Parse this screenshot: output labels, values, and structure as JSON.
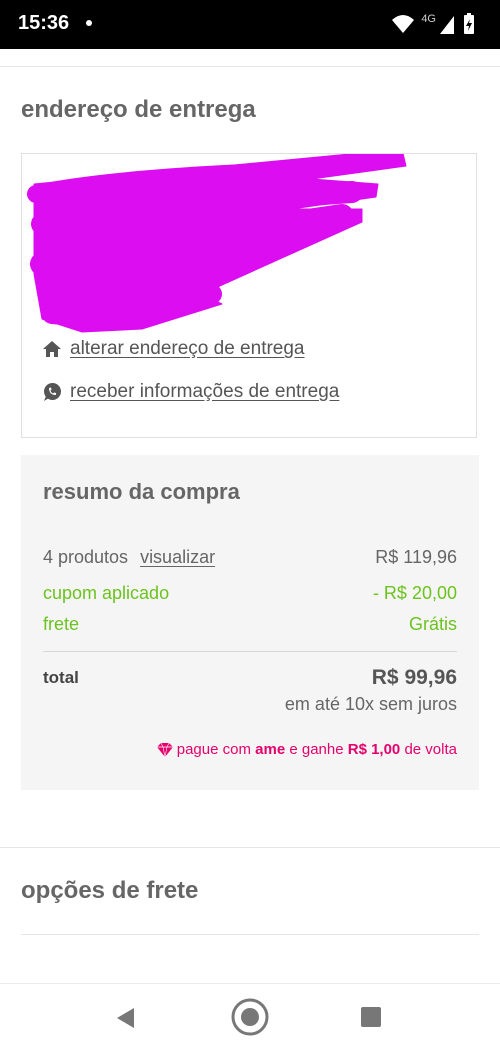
{
  "status_bar": {
    "time": "15:36",
    "network": "4G"
  },
  "delivery": {
    "title": "endereço de entrega",
    "change_address_label": "alterar endereço de entrega",
    "receive_info_label": "receber informações de entrega"
  },
  "summary": {
    "title": "resumo da compra",
    "products_label": "4 produtos",
    "view_link": "visualizar",
    "products_value": "R$ 119,96",
    "coupon_label": "cupom aplicado",
    "coupon_value": "- R$ 20,00",
    "shipping_label": "frete",
    "shipping_value": "Grátis",
    "total_label": "total",
    "total_value": "R$ 99,96",
    "installments": "em até 10x sem juros",
    "ame_prefix": "pague com ",
    "ame_brand": "ame",
    "ame_middle": " e ganhe ",
    "ame_amount": "R$ 1,00",
    "ame_suffix": " de volta"
  },
  "shipping_options": {
    "title": "opções de frete"
  },
  "colors": {
    "accent_green": "#6cc31f",
    "ame_pink": "#e5016d",
    "redaction": "#dc0df0"
  },
  "icons": {
    "home": "home-icon",
    "whatsapp": "whatsapp-icon",
    "ame": "ame-diamond-icon",
    "back": "back-icon",
    "home_nav": "home-nav-icon",
    "recents": "recents-icon"
  }
}
